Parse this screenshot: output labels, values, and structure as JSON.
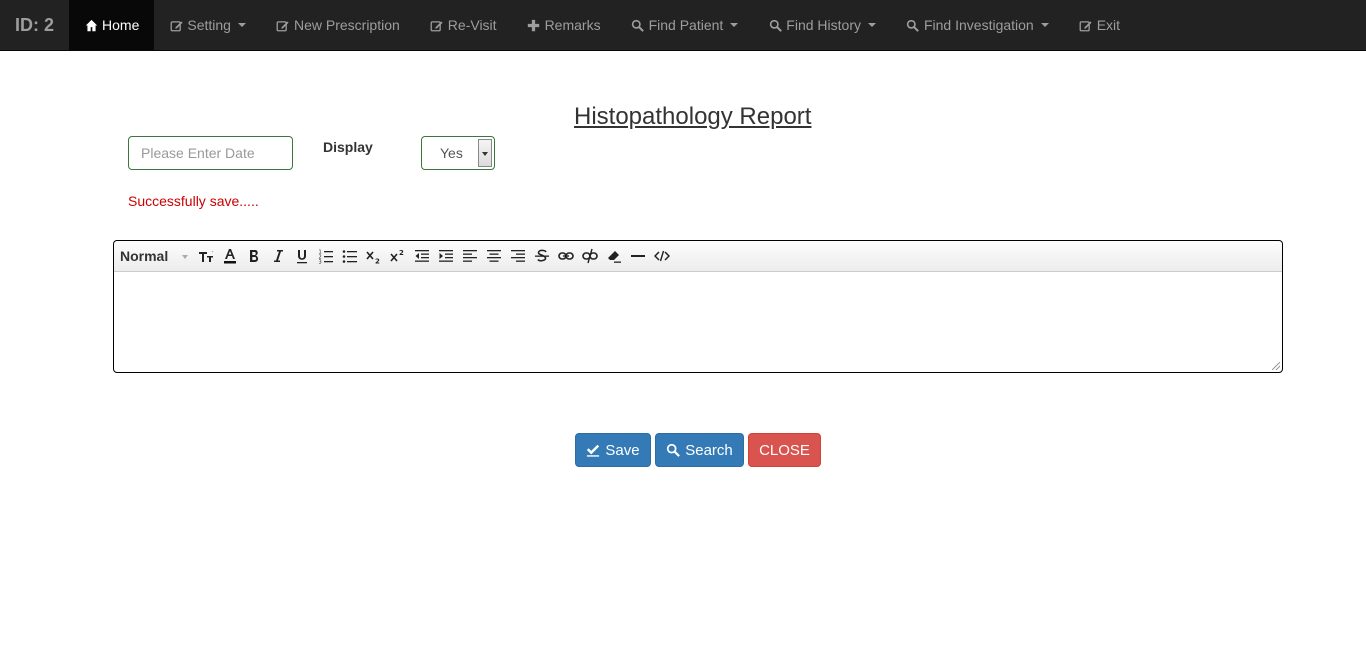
{
  "navbar": {
    "brand": "ID: 2",
    "items": [
      {
        "label": "Home",
        "icon": "home-icon",
        "active": true,
        "dropdown": false
      },
      {
        "label": "Setting",
        "icon": "edit-icon",
        "active": false,
        "dropdown": true
      },
      {
        "label": "New Prescription",
        "icon": "edit-icon",
        "active": false,
        "dropdown": false
      },
      {
        "label": "Re-Visit",
        "icon": "edit-icon",
        "active": false,
        "dropdown": false
      },
      {
        "label": "Remarks",
        "icon": "plus-icon",
        "active": false,
        "dropdown": false
      },
      {
        "label": "Find Patient",
        "icon": "search-icon",
        "active": false,
        "dropdown": true
      },
      {
        "label": "Find History",
        "icon": "search-icon",
        "active": false,
        "dropdown": true
      },
      {
        "label": "Find Investigation",
        "icon": "search-icon",
        "active": false,
        "dropdown": true
      },
      {
        "label": "Exit",
        "icon": "edit-icon",
        "active": false,
        "dropdown": false
      }
    ]
  },
  "page": {
    "title": "Histopathology Report"
  },
  "form": {
    "date_placeholder": "Please Enter Date",
    "date_value": "",
    "display_label": "Display",
    "display_selected": "Yes",
    "message": "Successfully save....."
  },
  "editor": {
    "style_label": "Normal",
    "content": ""
  },
  "buttons": {
    "save_label": "Save",
    "search_label": "Search",
    "close_label": "CLOSE"
  },
  "colors": {
    "navbar_bg": "#222222",
    "primary": "#337ab7",
    "danger": "#d9534f",
    "success_border": "#3c763d",
    "message": "#cc0000"
  }
}
